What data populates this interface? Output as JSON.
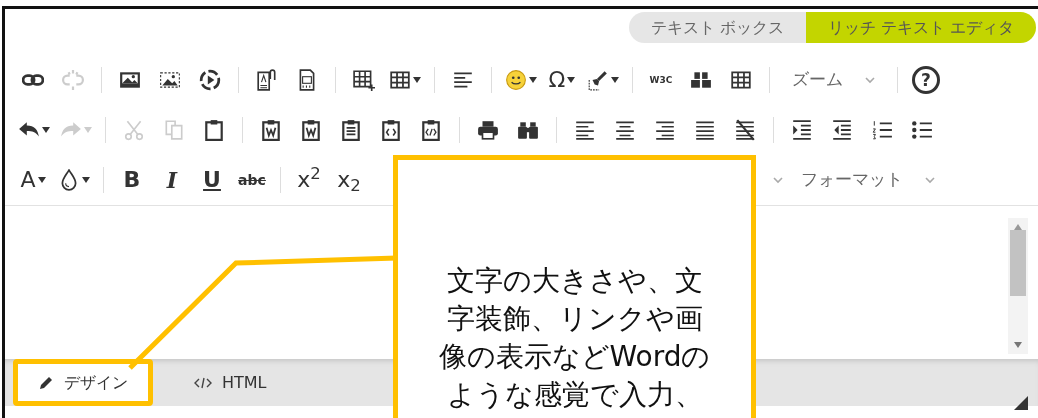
{
  "mode_switch": [
    {
      "label": "テキスト ボックス",
      "selected": false
    },
    {
      "label": "リッチ テキスト エディタ",
      "selected": true
    }
  ],
  "toolbar": [
    [
      {
        "kind": "button",
        "disabled": false
      },
      {
        "kind": "button",
        "disabled": true
      },
      {
        "kind": "separator"
      },
      {
        "kind": "button",
        "disabled": false
      },
      {
        "kind": "button",
        "disabled": false
      },
      {
        "kind": "button",
        "disabled": false
      },
      {
        "kind": "separator"
      },
      {
        "kind": "button",
        "disabled": false
      },
      {
        "kind": "button",
        "disabled": false
      },
      {
        "kind": "separator"
      },
      {
        "kind": "button",
        "disabled": false
      },
      {
        "kind": "button",
        "disabled": false,
        "menu": true
      },
      {
        "kind": "separator"
      },
      {
        "kind": "button",
        "disabled": false
      },
      {
        "kind": "separator"
      },
      {
        "kind": "button",
        "disabled": false,
        "menu": true
      },
      {
        "kind": "text_button",
        "label": "Ω",
        "disabled": false,
        "menu": true
      },
      {
        "kind": "button",
        "disabled": false,
        "menu": true
      },
      {
        "kind": "separator"
      },
      {
        "kind": "text_button",
        "label": "W3C",
        "disabled": false
      },
      {
        "kind": "button",
        "disabled": false
      },
      {
        "kind": "button",
        "disabled": false
      },
      {
        "kind": "separator"
      },
      {
        "kind": "dropdown",
        "label": "ズーム"
      },
      {
        "kind": "separator"
      },
      {
        "kind": "text_button",
        "label": "?",
        "disabled": false
      }
    ],
    [
      {
        "kind": "button",
        "disabled": false,
        "menu": true
      },
      {
        "kind": "button",
        "disabled": true,
        "menu": true
      },
      {
        "kind": "separator"
      },
      {
        "kind": "button",
        "disabled": true
      },
      {
        "kind": "button",
        "disabled": true
      },
      {
        "kind": "button",
        "disabled": false
      },
      {
        "kind": "separator"
      },
      {
        "kind": "button",
        "disabled": false
      },
      {
        "kind": "button",
        "disabled": false
      },
      {
        "kind": "button",
        "disabled": false
      },
      {
        "kind": "button",
        "disabled": false
      },
      {
        "kind": "button",
        "disabled": false
      },
      {
        "kind": "separator"
      },
      {
        "kind": "button",
        "disabled": false
      },
      {
        "kind": "button",
        "disabled": false
      },
      {
        "kind": "separator"
      },
      {
        "kind": "button",
        "disabled": false
      },
      {
        "kind": "button",
        "disabled": false
      },
      {
        "kind": "button",
        "disabled": false
      },
      {
        "kind": "button",
        "disabled": false
      },
      {
        "kind": "button",
        "disabled": false
      },
      {
        "kind": "separator"
      },
      {
        "kind": "button",
        "disabled": false
      },
      {
        "kind": "button",
        "disabled": false
      },
      {
        "kind": "button",
        "disabled": false
      },
      {
        "kind": "button",
        "disabled": false
      }
    ],
    [
      {
        "kind": "text_button",
        "label": "A",
        "disabled": false,
        "menu": true
      },
      {
        "kind": "button",
        "disabled": false,
        "menu": true
      },
      {
        "kind": "separator"
      },
      {
        "kind": "text_button",
        "label": "B",
        "disabled": false
      },
      {
        "kind": "text_button",
        "label": "I",
        "disabled": false
      },
      {
        "kind": "text_button",
        "label": "U",
        "disabled": false
      },
      {
        "kind": "text_button",
        "label": "abc",
        "disabled": false
      },
      {
        "kind": "separator"
      },
      {
        "kind": "text_button",
        "label": "x$^{2}$",
        "disabled": false
      },
      {
        "kind": "text_button",
        "label": "x$_{2}$",
        "disabled": false
      },
      {
        "kind": "gap"
      },
      {
        "kind": "caret"
      },
      {
        "kind": "dropdown",
        "label": "フォーマット"
      }
    ]
  ],
  "view_tabs": [
    {
      "label": "デザイン",
      "selected": true,
      "highlighted": true
    },
    {
      "label": "HTML",
      "selected": false,
      "highlighted": false
    }
  ],
  "callout": {
    "lines": [
      "文字の大きさや、文",
      "字装飾、リンクや画",
      "像の表示などWordの",
      "ような感覚で入力、"
    ]
  }
}
